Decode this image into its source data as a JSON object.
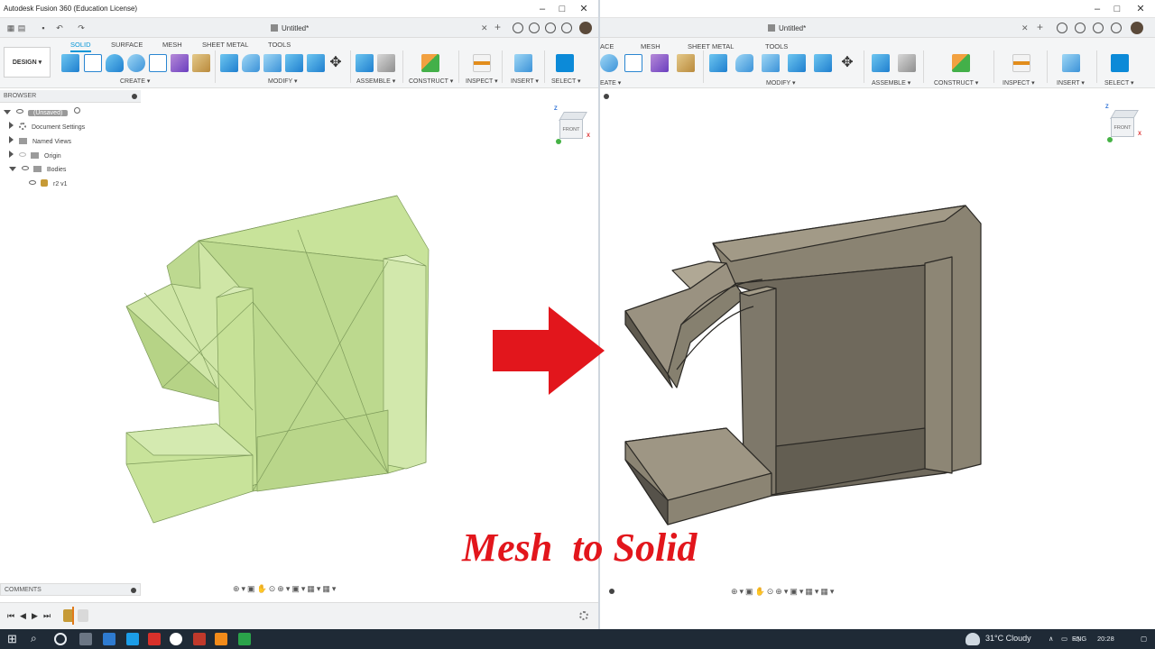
{
  "left_window": {
    "app_title": "Autodesk Fusion 360 (Education License)",
    "document_tab": "Untitled*",
    "mode_button": "DESIGN",
    "workspace_tabs": [
      "SOLID",
      "SURFACE",
      "MESH",
      "SHEET METAL",
      "TOOLS"
    ],
    "active_tab": "SOLID",
    "groups": [
      "CREATE",
      "MODIFY",
      "ASSEMBLE",
      "CONSTRUCT",
      "INSPECT",
      "INSERT",
      "SELECT"
    ],
    "browser": {
      "header": "BROWSER",
      "root": "(Unsaved)",
      "items": [
        "Document Settings",
        "Named Views",
        "Origin",
        "Bodies"
      ],
      "body_item": "r2 v1"
    },
    "comments_label": "COMMENTS",
    "viewcube": {
      "front": "FRONT",
      "z": "Z",
      "x": "X",
      "top": "TOP"
    }
  },
  "right_window": {
    "document_tab": "Untitled*",
    "workspace_tabs": [
      "ACE",
      "MESH",
      "SHEET METAL",
      "TOOLS"
    ],
    "groups": [
      "EATE",
      "MODIFY",
      "ASSEMBLE",
      "CONSTRUCT",
      "INSPECT",
      "INSERT",
      "SELECT"
    ],
    "viewcube": {
      "front": "FRONT",
      "z": "Z",
      "x": "X",
      "top": "TOP"
    }
  },
  "overlay": {
    "title": "Mesh  to Solid",
    "arrow_color": "#e2161c"
  },
  "taskbar": {
    "weather": "31°C  Cloudy",
    "language": "ENG",
    "time": "20:28"
  },
  "colors": {
    "mesh_body": "#c8e39a",
    "solid_body": "#807868",
    "accent": "#0696d7"
  }
}
